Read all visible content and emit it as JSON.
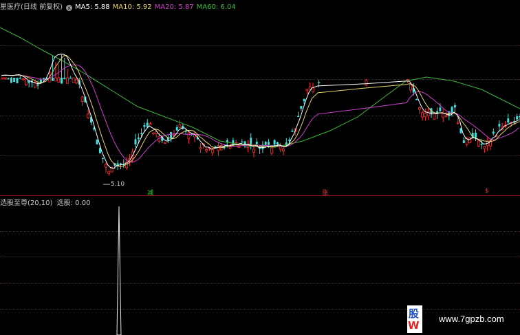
{
  "main_legend": {
    "title": "星医疗(日线 前复权)",
    "close_glyph": "x",
    "ma5": "MA5: 5.88",
    "ma10": "MA10: 5.92",
    "ma20": "MA20: 5.87",
    "ma60": "MA60: 6.04"
  },
  "colors": {
    "ma5": "#ffffff",
    "ma10": "#e8d468",
    "ma20": "#d040d0",
    "ma60": "#40b840",
    "up": "#ff3030",
    "down": "#40e0e0",
    "grid": "#6a1a1a",
    "divider": "#a01818"
  },
  "low_label": "5.10",
  "markers": [
    {
      "text": "减",
      "color": "#30d030"
    },
    {
      "text": "涨",
      "color": "#ff3030"
    },
    {
      "text": "$",
      "color": "#ff3030"
    }
  ],
  "sub_legend": {
    "title": "选股至尊(20,10)",
    "value": "选股: 0.00"
  },
  "watermark": {
    "logo_top": "股",
    "logo_bottom": "W",
    "url": "www.7gpzb.com"
  }
}
